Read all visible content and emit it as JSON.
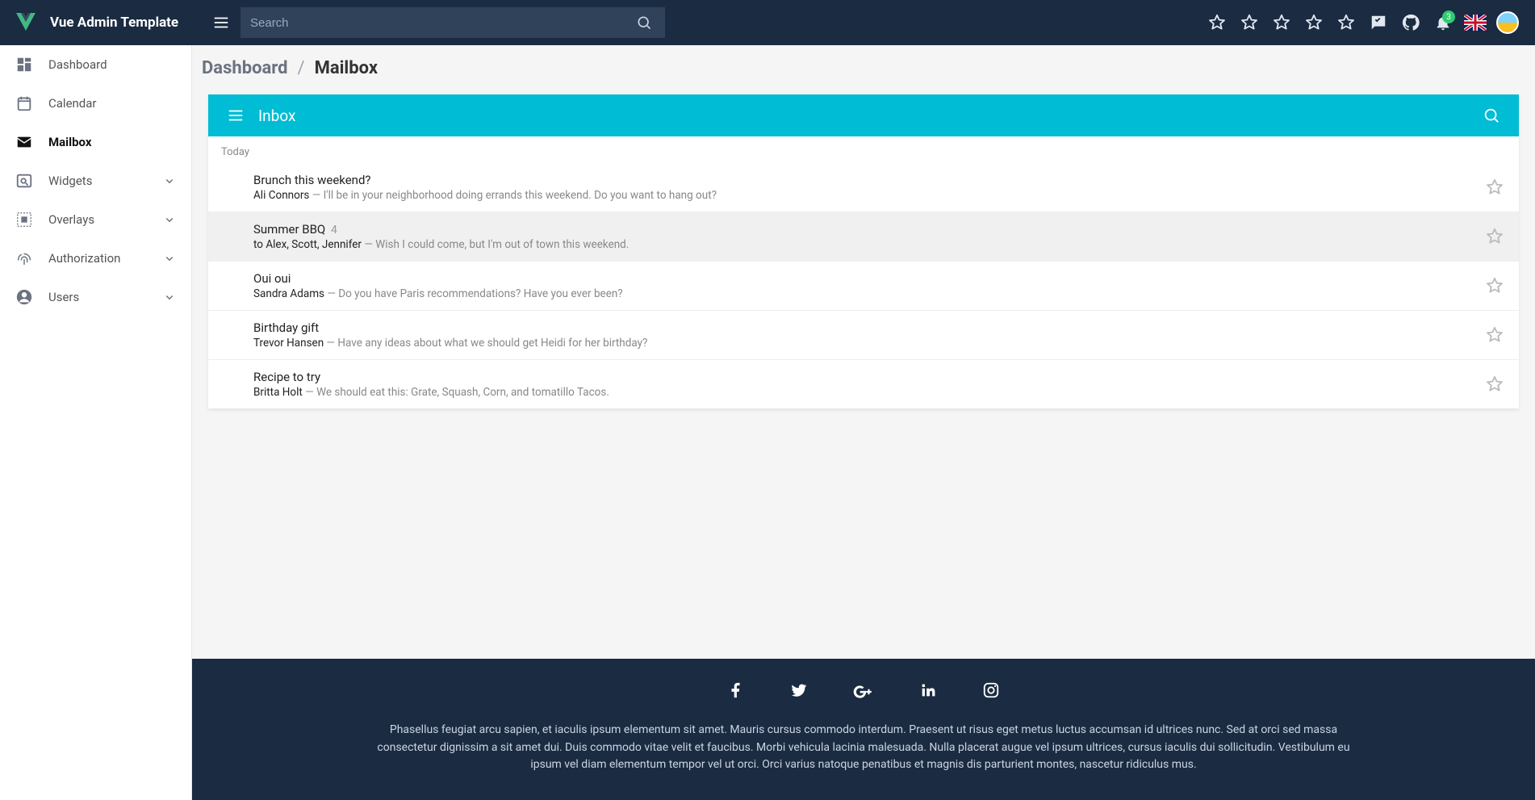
{
  "app": {
    "title": "Vue Admin Template"
  },
  "search": {
    "placeholder": "Search"
  },
  "notifications": {
    "count": "3"
  },
  "sidebar": {
    "items": [
      {
        "label": "Dashboard",
        "icon": "dashboard",
        "expandable": false,
        "active": false
      },
      {
        "label": "Calendar",
        "icon": "calendar",
        "expandable": false,
        "active": false
      },
      {
        "label": "Mailbox",
        "icon": "mail",
        "expandable": false,
        "active": true
      },
      {
        "label": "Widgets",
        "icon": "pageview",
        "expandable": true,
        "active": false
      },
      {
        "label": "Overlays",
        "icon": "select-all",
        "expandable": true,
        "active": false
      },
      {
        "label": "Authorization",
        "icon": "fingerprint",
        "expandable": true,
        "active": false
      },
      {
        "label": "Users",
        "icon": "account",
        "expandable": true,
        "active": false
      }
    ]
  },
  "breadcrumb": {
    "root": "Dashboard",
    "current": "Mailbox"
  },
  "mailbox": {
    "title": "Inbox",
    "section": "Today",
    "items": [
      {
        "title": "Brunch this weekend?",
        "count": "",
        "sender": "Ali Connors",
        "snippet": "I'll be in your neighborhood doing errands this weekend. Do you want to hang out?",
        "hovered": false
      },
      {
        "title": "Summer BBQ",
        "count": "4",
        "sender": "to Alex, Scott, Jennifer",
        "snippet": "Wish I could come, but I'm out of town this weekend.",
        "hovered": true
      },
      {
        "title": "Oui oui",
        "count": "",
        "sender": "Sandra Adams",
        "snippet": "Do you have Paris recommendations? Have you ever been?",
        "hovered": false
      },
      {
        "title": "Birthday gift",
        "count": "",
        "sender": "Trevor Hansen",
        "snippet": "Have any ideas about what we should get Heidi for her birthday?",
        "hovered": false
      },
      {
        "title": "Recipe to try",
        "count": "",
        "sender": "Britta Holt",
        "snippet": "We should eat this: Grate, Squash, Corn, and tomatillo Tacos.",
        "hovered": false
      }
    ]
  },
  "footer": {
    "text": "Phasellus feugiat arcu sapien, et iaculis ipsum elementum sit amet. Mauris cursus commodo interdum. Praesent ut risus eget metus luctus accumsan id ultrices nunc. Sed at orci sed massa consectetur dignissim a sit amet dui. Duis commodo vitae velit et faucibus. Morbi vehicula lacinia malesuada. Nulla placerat augue vel ipsum ultrices, cursus iaculis dui sollicitudin. Vestibulum eu ipsum vel diam elementum tempor vel ut orci. Orci varius natoque penatibus et magnis dis parturient montes, nascetur ridiculus mus."
  }
}
